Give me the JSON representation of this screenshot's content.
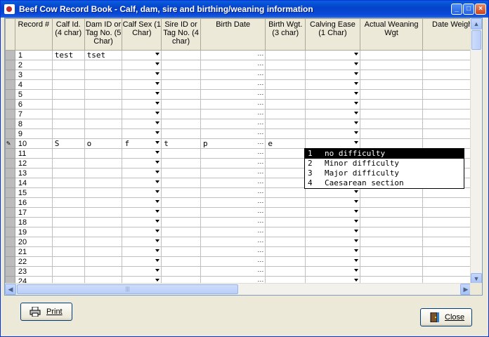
{
  "window": {
    "title": "Beef Cow Record Book - Calf, dam, sire and birthing/weaning information"
  },
  "columns": [
    "Record #",
    "Calf Id. (4 char)",
    "Dam ID or Tag No. (5 Char)",
    "Calf Sex (1 Char)",
    "Sire ID or Tag No. (4 char)",
    "Birth Date",
    "Birth Wgt. (3 char)",
    "Calving Ease (1 Char)",
    "Actual Weaning Wgt",
    "Date Weigh"
  ],
  "rows": [
    {
      "num": "1",
      "calf_id": "test",
      "dam_id": "tset",
      "sex": "",
      "sire": "",
      "birth_date": "",
      "birth_wgt": ""
    },
    {
      "num": "2"
    },
    {
      "num": "3"
    },
    {
      "num": "4"
    },
    {
      "num": "5"
    },
    {
      "num": "6"
    },
    {
      "num": "7"
    },
    {
      "num": "8"
    },
    {
      "num": "9"
    },
    {
      "num": "10",
      "calf_id": "S",
      "dam_id": "o",
      "sex": "f",
      "sire": "t",
      "birth_date": "p",
      "birth_wgt": "e",
      "editing": true
    },
    {
      "num": "11"
    },
    {
      "num": "12"
    },
    {
      "num": "13"
    },
    {
      "num": "14"
    },
    {
      "num": "15"
    },
    {
      "num": "16"
    },
    {
      "num": "17"
    },
    {
      "num": "18"
    },
    {
      "num": "19"
    },
    {
      "num": "20"
    },
    {
      "num": "21"
    },
    {
      "num": "22"
    },
    {
      "num": "23"
    },
    {
      "num": "24"
    }
  ],
  "calving_ease_dropdown": [
    {
      "key": "1",
      "label": "no difficulty",
      "selected": true
    },
    {
      "key": "2",
      "label": "Minor difficulty"
    },
    {
      "key": "3",
      "label": "Major difficulty"
    },
    {
      "key": "4",
      "label": "Caesarean section"
    }
  ],
  "buttons": {
    "print": "Print",
    "close": "Close"
  },
  "icons": {
    "title": "app-icon",
    "print": "printer-icon",
    "close": "exit-door-icon",
    "edit": "pencil-icon"
  }
}
